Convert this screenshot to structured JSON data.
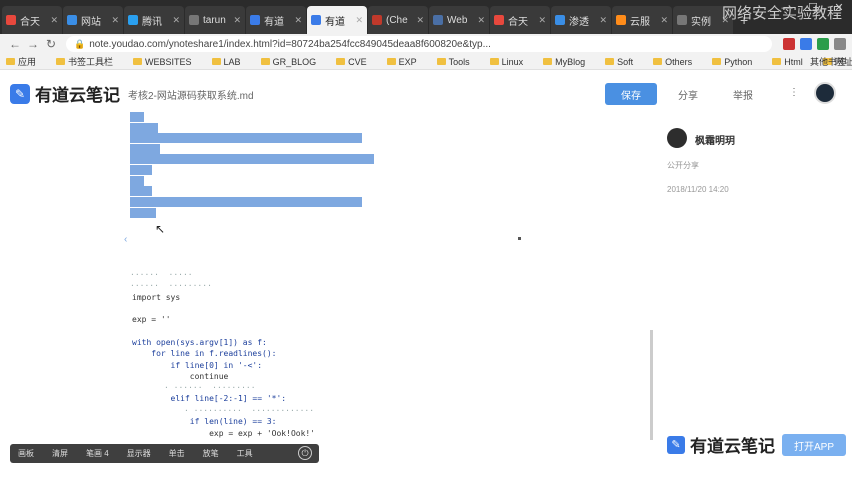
{
  "browser": {
    "tabs": [
      {
        "label": "合天",
        "active": false,
        "color": "#e8483d"
      },
      {
        "label": "网站",
        "active": false,
        "color": "#3a8ee6"
      },
      {
        "label": "腾讯",
        "active": false,
        "color": "#2aa0f0"
      },
      {
        "label": "tarun",
        "active": false,
        "color": "#777777"
      },
      {
        "label": "有道",
        "active": false,
        "color": "#3a7be8"
      },
      {
        "label": "有道",
        "active": true,
        "color": "#3a7be8"
      },
      {
        "label": "(Che",
        "active": false,
        "color": "#c0392b"
      },
      {
        "label": "Web",
        "active": false,
        "color": "#4a6fa5"
      },
      {
        "label": "合天",
        "active": false,
        "color": "#e8483d"
      },
      {
        "label": "渗透",
        "active": false,
        "color": "#3a8ee6"
      },
      {
        "label": "云服",
        "active": false,
        "color": "#ff8c1a"
      },
      {
        "label": "实例",
        "active": false,
        "color": "#777777"
      }
    ],
    "new_tab": "+",
    "watermark": "网络安全实验教程",
    "window_controls": [
      "—",
      "☐",
      "✕"
    ],
    "nav": {
      "back": "←",
      "forward": "→",
      "reload": "↻"
    },
    "url": "note.youdao.com/ynoteshare1/index.html?id=80724ba254fcc849045deaa8f600820e&typ...",
    "bookmarks": [
      "应用",
      "书签工具栏",
      "WEBSITES",
      "LAB",
      "GR_BLOG",
      "CVE",
      "EXP",
      "Tools",
      "Linux",
      "MyBlog",
      "Soft",
      "Others",
      "Python",
      "Html",
      "网址导航"
    ],
    "bookmarks_other": "其他书签"
  },
  "header": {
    "logo_text": "有道云笔记",
    "doc_title": "考核2-网站源码获取系统.md",
    "primary_button": "保存",
    "links": [
      "分享",
      "举报",
      "⋮"
    ]
  },
  "code": {
    "lines": [
      {
        "text": "import sys",
        "kind": "kw"
      },
      {
        "text": "exp = ''",
        "kind": "plain"
      },
      {
        "text": "with open(sys.argv[1]) as f:",
        "kind": "kw"
      },
      {
        "text": "    for line in f.readlines():",
        "kind": "kw"
      },
      {
        "text": "        if line[0] in '-<':",
        "kind": "kw"
      },
      {
        "text": "            continue",
        "kind": "plain"
      },
      {
        "text": "        elif line[-2:-1] == '*':",
        "kind": "kw"
      },
      {
        "text": "            if len(line) == 3:",
        "kind": "kw"
      },
      {
        "text": "                exp = exp + 'Ook!Ook!'",
        "kind": "plain"
      }
    ],
    "collapse_glyph": "‹",
    "cursor_glyph": "↖"
  },
  "sidebar": {
    "author": "枫霜明玥",
    "meta_lines": [
      "公开分享",
      "2018/11/20 14:20"
    ]
  },
  "footer": {
    "logo_text": "有道云笔记",
    "button": "打开APP"
  },
  "player": {
    "buttons": [
      "画板",
      "清屏",
      "笔画 4",
      "显示器",
      "单击",
      "放笔",
      "工具"
    ],
    "power": "⏻"
  }
}
